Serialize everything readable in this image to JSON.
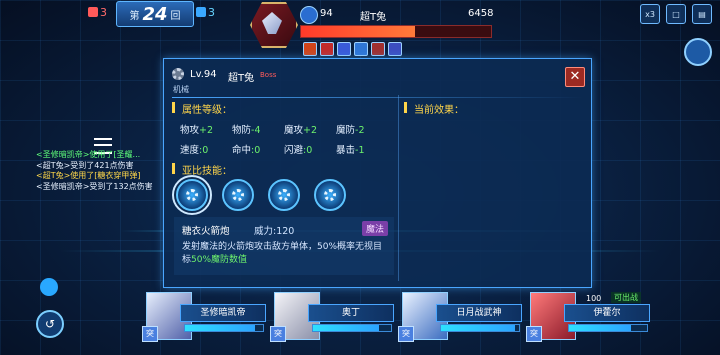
{
  "top": {
    "red_score": "3",
    "round_prefix": "第",
    "round_number": "24",
    "round_suffix": "回",
    "blue_score": "3"
  },
  "enemy": {
    "level": "94",
    "name": "超T兔",
    "hp": "6458",
    "hp_fraction": 0.6
  },
  "right_buttons": [
    "x3",
    "□",
    "▤"
  ],
  "battle_log": [
    {
      "text": "<圣修暗凯帝>使用了[圣耀...",
      "color": "g"
    },
    {
      "text": "<超T兔>受到了421点伤害",
      "color": "w"
    },
    {
      "text": "<超T兔>使用了[糖衣穿甲弹]",
      "color": "y"
    },
    {
      "text": "<圣修暗凯帝>受到了132点伤害",
      "color": "w"
    }
  ],
  "modal": {
    "level": "Lv.94",
    "name": "超T兔",
    "boss_tag": "Boss",
    "type": "机械",
    "close": "✕",
    "attr_title": "属性等级：",
    "effects_title": "当前效果：",
    "skills_title": "亚比技能：",
    "stats": [
      [
        {
          "label": "物攻",
          "value": "+2"
        },
        {
          "label": "物防",
          "value": "-4"
        },
        {
          "label": "魔攻",
          "value": "+2"
        },
        {
          "label": "魔防",
          "value": "-2"
        }
      ],
      [
        {
          "label": "速度",
          "value": ":0"
        },
        {
          "label": "命中",
          "value": ":0"
        },
        {
          "label": "闪避",
          "value": ":0"
        },
        {
          "label": "暴击",
          "value": "-1"
        }
      ]
    ],
    "skill": {
      "name": "糖衣火箭炮",
      "power": "威力:120",
      "tag": "魔法",
      "desc_main": "发射魔法的火箭炮攻击敌方单体，50%概率无视目标",
      "desc_highlight": "50%魔防数值"
    }
  },
  "team": [
    {
      "name": "圣修暗凯帝",
      "hp_fraction": 0.9,
      "tag": "突"
    },
    {
      "name": "奥丁",
      "hp_fraction": 0.85,
      "tag": "突"
    },
    {
      "name": "日月战武神",
      "hp_fraction": 0.95,
      "tag": "突"
    },
    {
      "name": "伊藿尔",
      "hp_fraction": 0.8,
      "tag": "突",
      "hp_num": "100",
      "status": "可出战"
    }
  ]
}
